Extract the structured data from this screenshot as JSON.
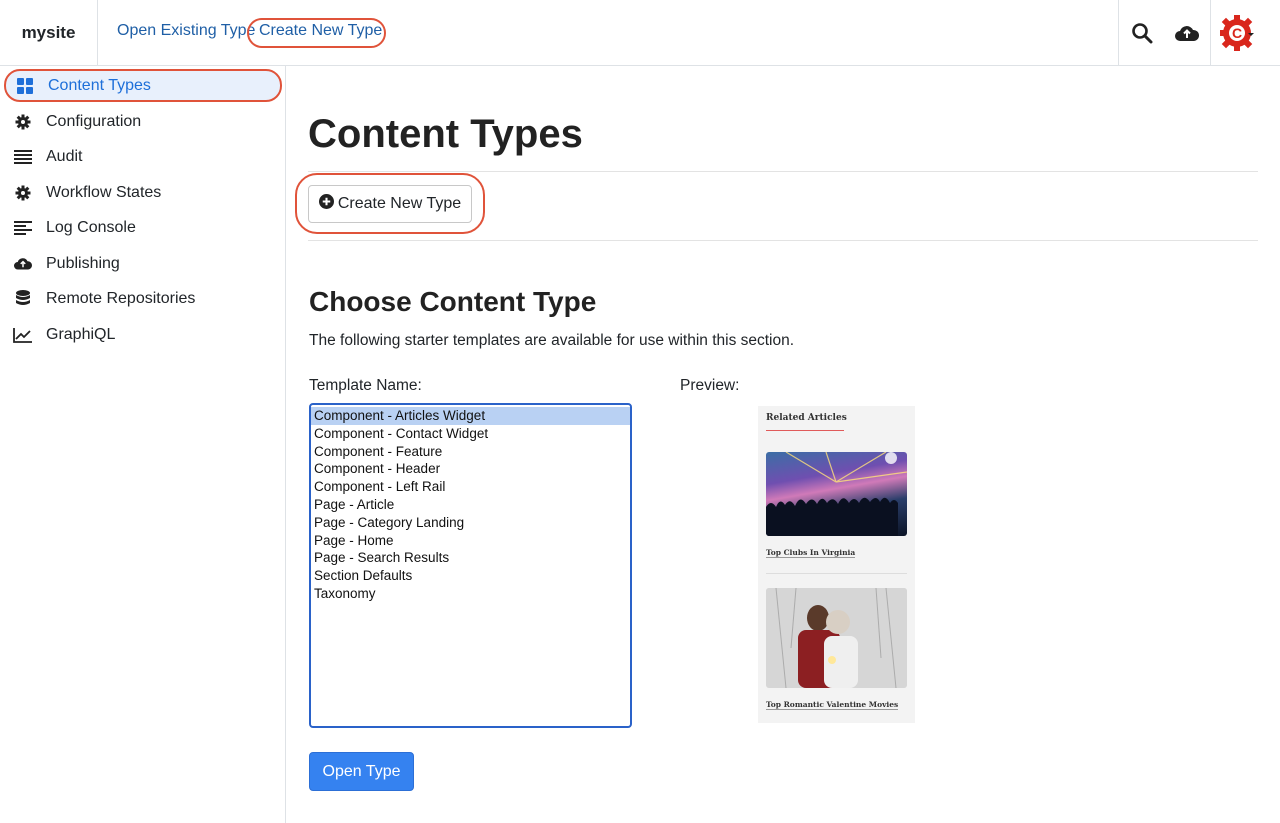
{
  "topbar": {
    "site_name": "mysite",
    "open_existing_label": "Open Existing Type",
    "create_new_label": "Create New Type",
    "icons": [
      "search-icon",
      "cloud-upload-icon",
      "crafter-logo-icon"
    ]
  },
  "sidebar": {
    "items": [
      {
        "label": "Content Types",
        "icon": "grid-icon",
        "active": true
      },
      {
        "label": "Configuration",
        "icon": "gear-icon"
      },
      {
        "label": "Audit",
        "icon": "list-icon"
      },
      {
        "label": "Workflow States",
        "icon": "gear-icon"
      },
      {
        "label": "Log Console",
        "icon": "align-left-icon"
      },
      {
        "label": "Publishing",
        "icon": "cloud-upload-icon"
      },
      {
        "label": "Remote Repositories",
        "icon": "database-icon"
      },
      {
        "label": "GraphiQL",
        "icon": "chart-line-icon"
      }
    ]
  },
  "main": {
    "title": "Content Types",
    "create_button_label": "Create New Type",
    "section_title": "Choose Content Type",
    "section_description": "The following starter templates are available for use within this section.",
    "template_name_label": "Template Name:",
    "preview_label": "Preview:",
    "templates": [
      "Component - Articles Widget",
      "Component - Contact Widget",
      "Component - Feature",
      "Component - Header",
      "Component - Left Rail",
      "Page - Article",
      "Page - Category Landing",
      "Page - Home",
      "Page - Search Results",
      "Section Defaults",
      "Taxonomy"
    ],
    "selected_template": "Component - Articles Widget",
    "open_button_label": "Open Type"
  },
  "preview": {
    "heading": "Related Articles",
    "items": [
      "Top Clubs In Virginia",
      "Top Romantic Valentine Movies"
    ]
  },
  "colors": {
    "accent": "#3582f0",
    "link": "#1f5fa6",
    "highlight": "#e0533a",
    "logo_red": "#d9261c"
  }
}
